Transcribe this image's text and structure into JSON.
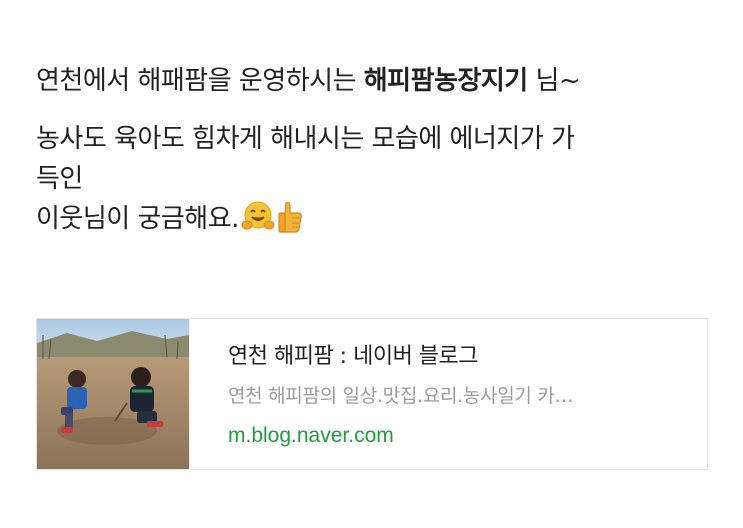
{
  "post": {
    "line1_prefix": "연천에서 해패팜을 운영하시는 ",
    "line1_bold": "해피팜농장지기",
    "line1_suffix": " 님~",
    "line2": "농사도 육아도 힘차게 해내시는 모습에 에너지가 가",
    "line3": "득인",
    "line4": "이웃님이 궁금해요.",
    "emojis": [
      "hugging-face-icon",
      "thumbs-up-icon"
    ]
  },
  "link_card": {
    "title": "연천 해피팜 : 네이버 블로그",
    "description": "연천 해피팜의 일상.맛집.요리.농사일기 카…",
    "url": "m.blog.naver.com",
    "thumbnail": "children-digging-dirt-photo",
    "url_color": "#1f9d3f"
  }
}
